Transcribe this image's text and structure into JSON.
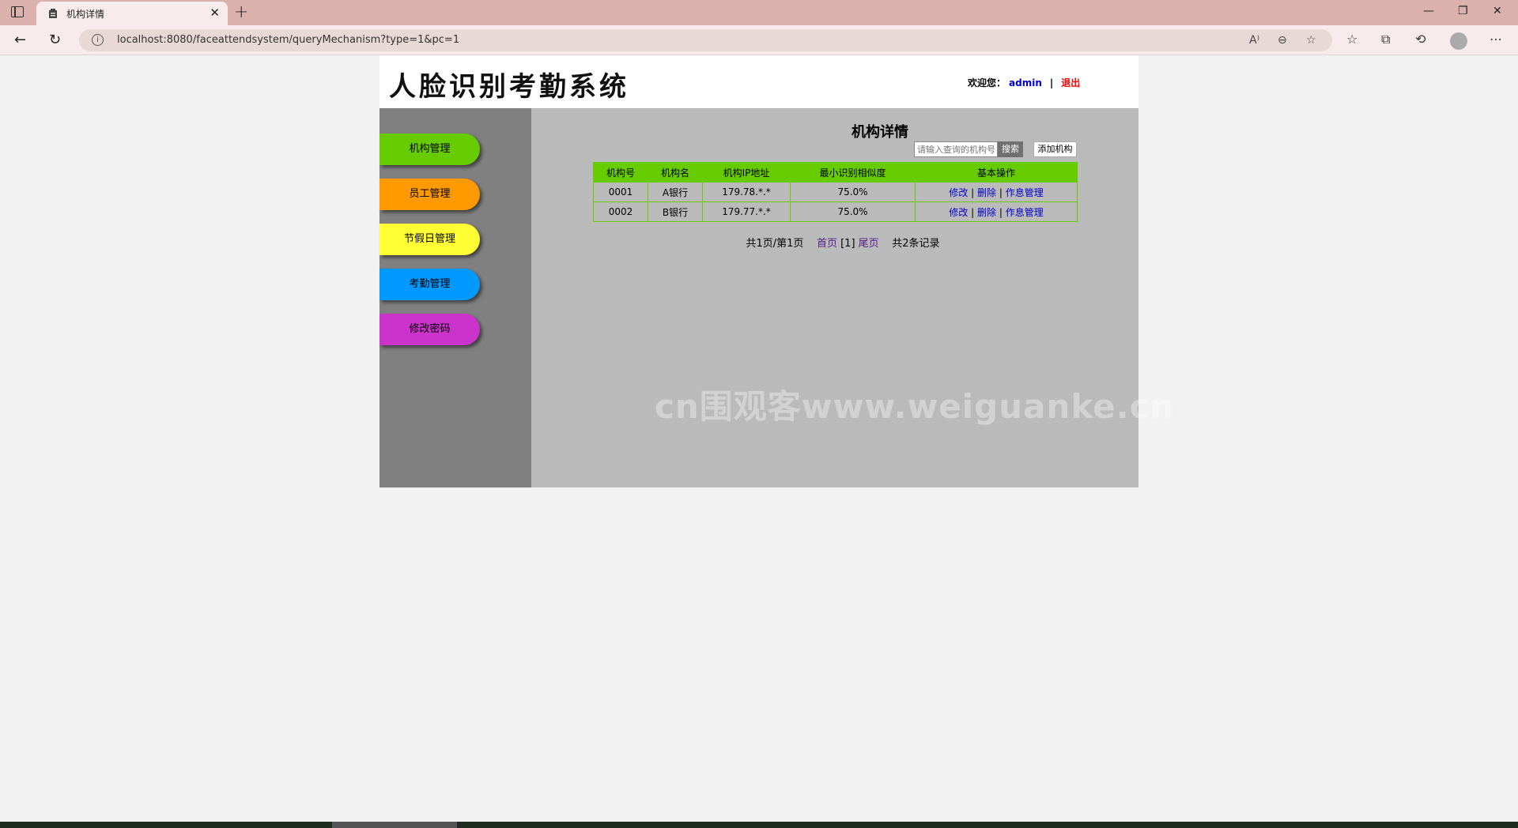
{
  "browser": {
    "tab_title": "机构详情",
    "url": "localhost:8080/faceattendsystem/queryMechanism?type=1&pc=1"
  },
  "header": {
    "logo_text": "人脸识别考勤系统",
    "welcome_label": "欢迎您：",
    "username": "admin",
    "separator": "|",
    "logout": "退出"
  },
  "sidebar": {
    "items": [
      {
        "label": "机构管理",
        "color": "#66cc00"
      },
      {
        "label": "员工管理",
        "color": "#ff9900"
      },
      {
        "label": "节假日管理",
        "color": "#ffff33"
      },
      {
        "label": "考勤管理",
        "color": "#0099ff"
      },
      {
        "label": "修改密码",
        "color": "#cc33cc"
      }
    ]
  },
  "main": {
    "title": "机构详情",
    "search_placeholder": "请输入查询的机构号",
    "search_button": "搜索",
    "add_button": "添加机构",
    "table": {
      "headers": [
        "机构号",
        "机构名",
        "机构IP地址",
        "最小识别相似度",
        "基本操作"
      ],
      "rows": [
        {
          "id": "0001",
          "name": "A银行",
          "ip": "179.78.*.*",
          "similarity": "75.0%"
        },
        {
          "id": "0002",
          "name": "B银行",
          "ip": "179.77.*.*",
          "similarity": "75.0%"
        }
      ],
      "actions": {
        "edit": "修改",
        "delete": "删除",
        "schedule": "作息管理",
        "sep": "|"
      }
    },
    "pager": {
      "summary": "共1页/第1页",
      "first": "首页",
      "current": "[1]",
      "last": "尾页",
      "total": "共2条记录"
    },
    "watermark": "cn围观客www.weiguanke.cn"
  }
}
